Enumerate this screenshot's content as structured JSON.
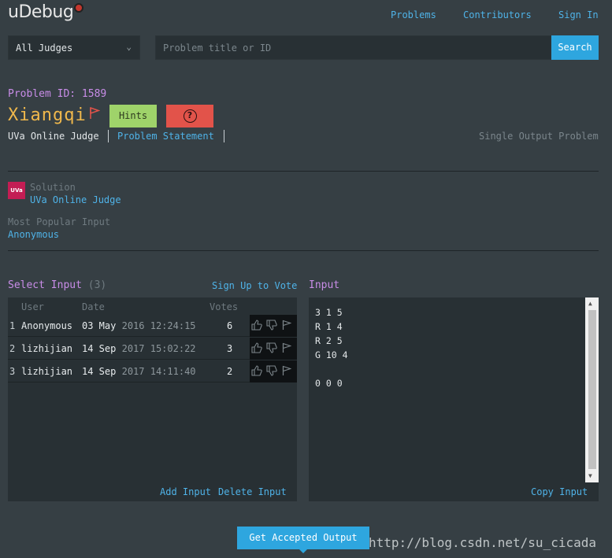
{
  "header": {
    "logo": "uDebug",
    "nav": [
      "Problems",
      "Contributors",
      "Sign In"
    ]
  },
  "search": {
    "judge_select": "All Judges",
    "placeholder": "Problem title or ID",
    "button": "Search"
  },
  "problem": {
    "id_label": "Problem ID: 1589",
    "title": "Xiangqi",
    "hints_label": "Hints",
    "help_label": "?",
    "judge": "UVa Online Judge",
    "statement_link": "Problem Statement",
    "output_type": "Single Output Problem"
  },
  "solution": {
    "badge": "UVa",
    "label": "Solution",
    "source": "UVa Online Judge",
    "popular_label": "Most Popular Input",
    "popular_value": "Anonymous"
  },
  "inputs": {
    "title": "Select Input",
    "count": "(3)",
    "signup": "Sign Up to Vote",
    "headers": {
      "user": "User",
      "date": "Date",
      "votes": "Votes"
    },
    "rows": [
      {
        "num": "1",
        "user": "Anonymous",
        "date": "03 May",
        "year_time": "2016 12:24:15",
        "votes": "6"
      },
      {
        "num": "2",
        "user": "lizhijian",
        "date": "14 Sep",
        "year_time": "2017 15:02:22",
        "votes": "3"
      },
      {
        "num": "3",
        "user": "lizhijian",
        "date": "14 Sep",
        "year_time": "2017 14:11:40",
        "votes": "2"
      }
    ],
    "add": "Add Input",
    "delete": "Delete Input"
  },
  "input_panel": {
    "title": "Input",
    "text": "3 1 5\nR 1 4\nR 2 5\nG 10 4\n\n0 0 0",
    "copy": "Copy Input"
  },
  "footer": {
    "get_output": "Get Accepted Output",
    "watermark": "http://blog.csdn.net/su_cicada"
  },
  "colors": {
    "background": "#363f44",
    "panel": "#283034",
    "link": "#4fb3e8",
    "title_orange": "#f0b84c",
    "label_purple": "#c98de8",
    "hints_green": "#9fd36a",
    "help_red": "#e2534a",
    "button_blue": "#2ea6df"
  }
}
